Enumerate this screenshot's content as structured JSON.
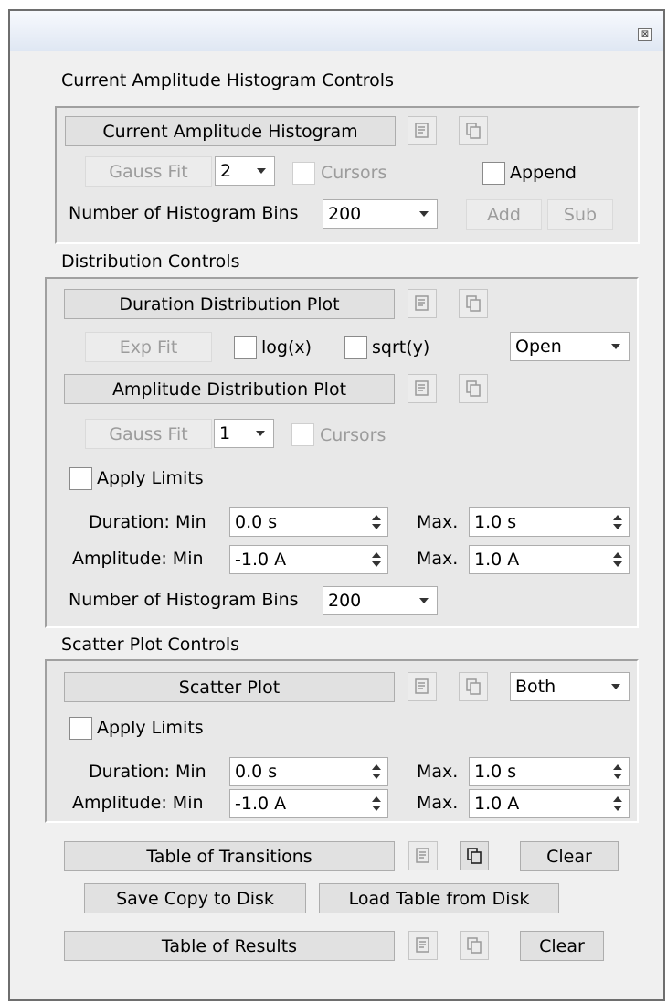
{
  "window": {
    "close_icon": "close-icon"
  },
  "current_amplitude": {
    "section_title": "Current Amplitude Histogram Controls",
    "histogram_button": "Current Amplitude Histogram",
    "gauss_fit_button": "Gauss Fit",
    "gauss_count": "2",
    "cursors_label": "Cursors",
    "append_label": "Append",
    "bins_label": "Number of Histogram Bins",
    "bins_value": "200",
    "add_button": "Add",
    "sub_button": "Sub"
  },
  "distribution": {
    "section_title": "Distribution Controls",
    "duration_plot_button": "Duration Distribution Plot",
    "exp_fit_button": "Exp Fit",
    "logx_label": "log(x)",
    "sqrty_label": "sqrt(y)",
    "state_value": "Open",
    "amplitude_plot_button": "Amplitude Distribution Plot",
    "gauss_fit_button": "Gauss Fit",
    "gauss_count": "1",
    "cursors_label": "Cursors",
    "apply_limits_label": "Apply Limits",
    "duration_min_label": "Duration: Min",
    "duration_min_value": "0.0 s",
    "duration_max_label": "Max.",
    "duration_max_value": "1.0 s",
    "amplitude_min_label": "Amplitude: Min",
    "amplitude_min_value": "-1.0 A",
    "amplitude_max_label": "Max.",
    "amplitude_max_value": "1.0 A",
    "bins_label": "Number of Histogram Bins",
    "bins_value": "200"
  },
  "scatter": {
    "section_title": "Scatter Plot Controls",
    "scatter_button": "Scatter Plot",
    "mode_value": "Both",
    "apply_limits_label": "Apply Limits",
    "duration_min_label": "Duration: Min",
    "duration_min_value": "0.0 s",
    "duration_max_label": "Max.",
    "duration_max_value": "1.0 s",
    "amplitude_min_label": "Amplitude: Min",
    "amplitude_min_value": "-1.0 A",
    "amplitude_max_label": "Max.",
    "amplitude_max_value": "1.0 A"
  },
  "tables": {
    "transitions_button": "Table of Transitions",
    "transitions_clear": "Clear",
    "save_copy_button": "Save Copy to Disk",
    "load_table_button": "Load Table from Disk",
    "results_button": "Table of Results",
    "results_clear": "Clear"
  },
  "icons": {
    "script": "script-icon",
    "copy": "copy-icon"
  },
  "colors": {
    "panel_bg": "#f0f0f0",
    "group_bg": "#e8e8e8",
    "disabled_text": "#9c9c9c"
  }
}
